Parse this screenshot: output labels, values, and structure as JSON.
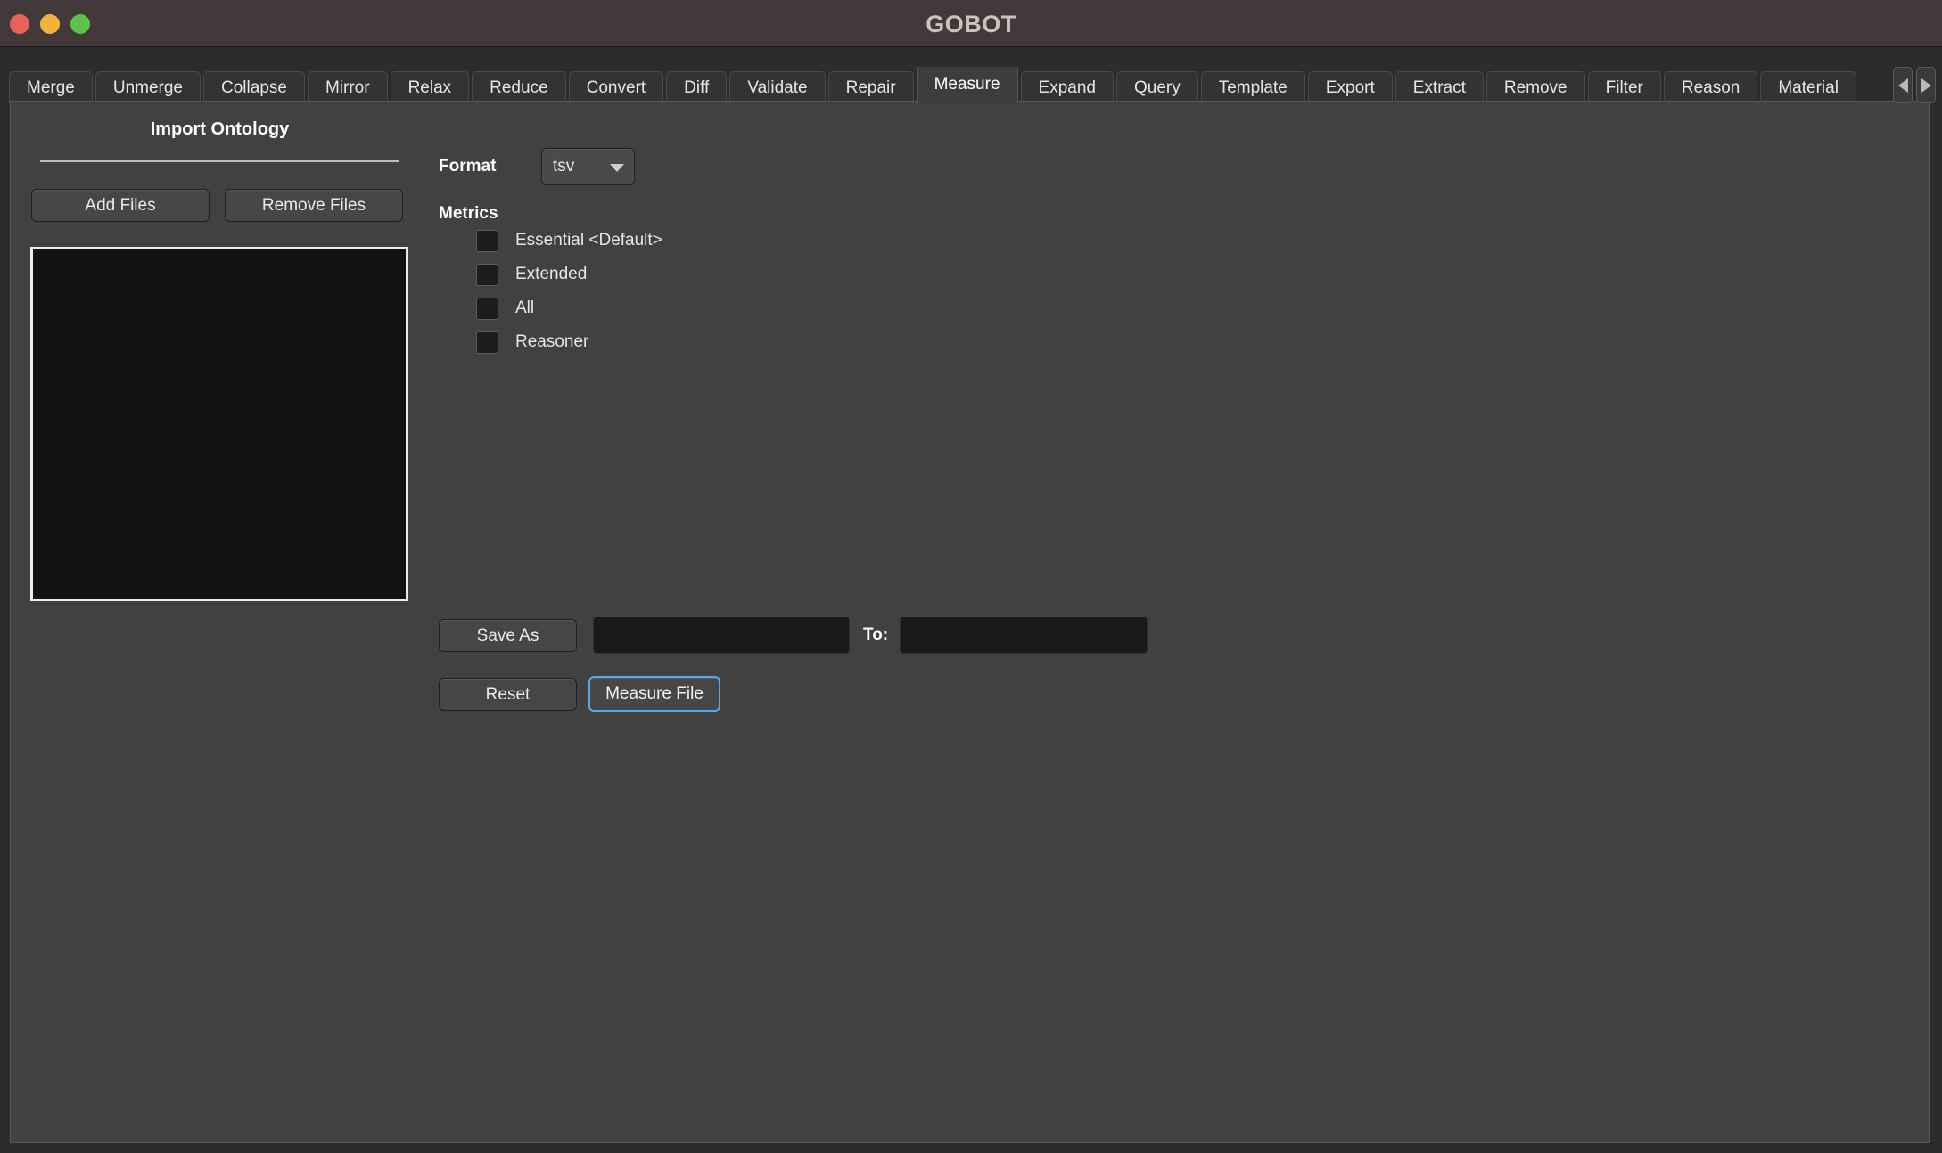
{
  "window": {
    "title": "GOBOT",
    "traffic_lights": [
      {
        "name": "close-button",
        "color": "#e8615a"
      },
      {
        "name": "minimize-button",
        "color": "#f0b43c"
      },
      {
        "name": "maximize-button",
        "color": "#5cc14a"
      }
    ]
  },
  "tabs": {
    "items": [
      "Merge",
      "Unmerge",
      "Collapse",
      "Mirror",
      "Relax",
      "Reduce",
      "Convert",
      "Diff",
      "Validate",
      "Repair",
      "Measure",
      "Expand",
      "Query",
      "Template",
      "Export",
      "Extract",
      "Remove",
      "Filter",
      "Reason",
      "Material"
    ],
    "selected": "Measure",
    "scroll_left_icon": "chevron-left-icon",
    "scroll_right_icon": "chevron-right-icon"
  },
  "import_panel": {
    "title": "Import Ontology",
    "add_files_label": "Add Files",
    "remove_files_label": "Remove Files",
    "file_list_items": []
  },
  "options": {
    "format_label": "Format",
    "format_value": "tsv",
    "format_options": [
      "tsv"
    ],
    "metrics_label": "Metrics",
    "metrics": [
      {
        "label": "Essential <Default>",
        "checked": false
      },
      {
        "label": "Extended",
        "checked": false
      },
      {
        "label": "All",
        "checked": false
      },
      {
        "label": "Reasoner",
        "checked": false
      }
    ]
  },
  "output": {
    "save_as_label": "Save As",
    "save_as_value": "",
    "save_as_placeholder": "",
    "to_label": "To:",
    "to_value": "",
    "to_placeholder": ""
  },
  "actions": {
    "reset_label": "Reset",
    "primary_label": "Measure File",
    "primary_focus_color": "#58a7e8"
  }
}
